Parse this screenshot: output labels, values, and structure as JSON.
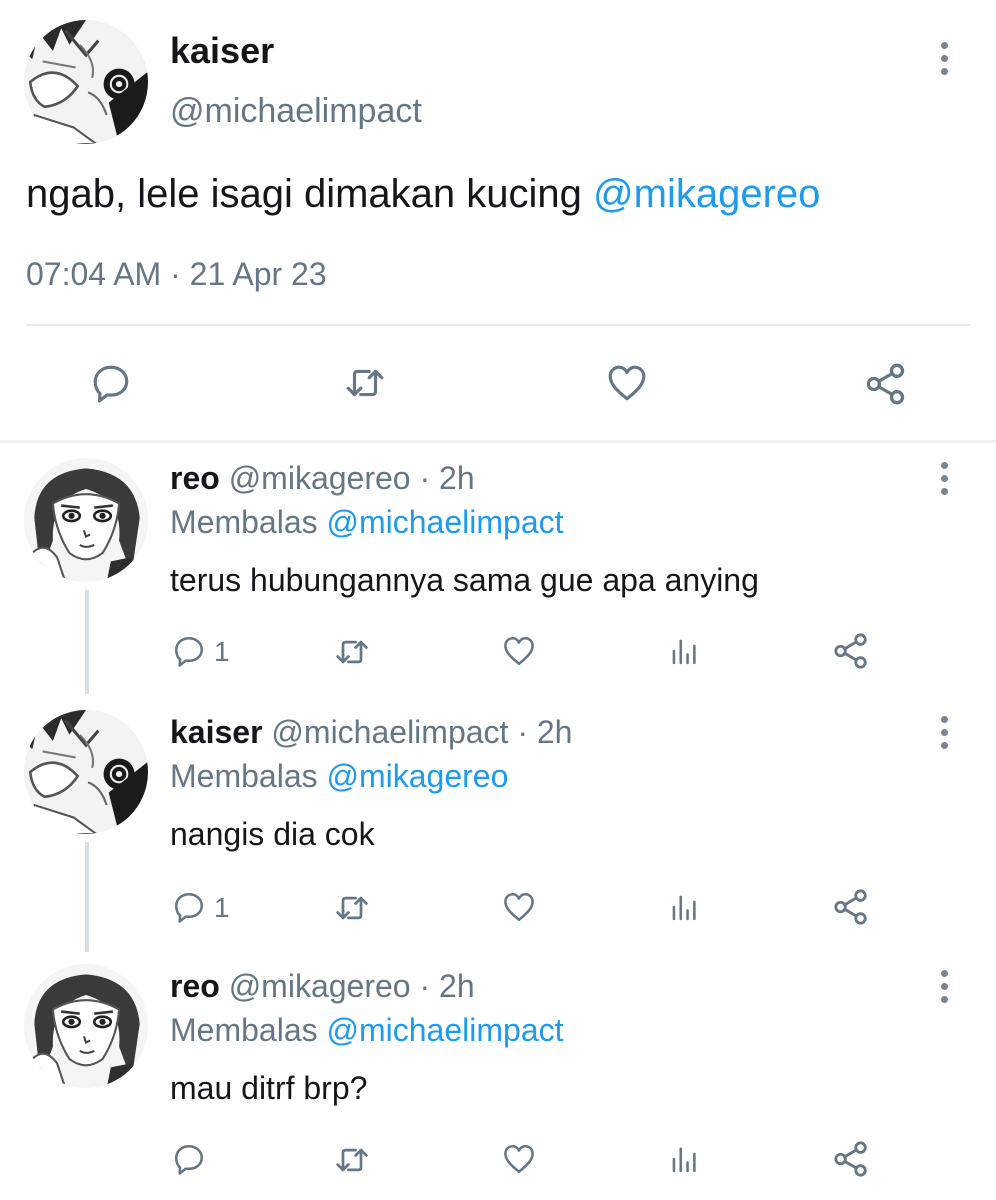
{
  "main_tweet": {
    "name": "kaiser",
    "handle": "@michaelimpact",
    "text": "ngab, lele isagi dimakan kucing ",
    "mention": "@mikagereo",
    "time": "07:04 AM",
    "separator": " · ",
    "date": "21 Apr 23"
  },
  "replies": [
    {
      "name": "reo",
      "handle": "@mikagereo",
      "age": "2h",
      "reply_label": "Membalas ",
      "reply_to": "@michaelimpact",
      "text": "terus hubungannya sama gue apa anying",
      "reply_count": "1"
    },
    {
      "name": "kaiser",
      "handle": "@michaelimpact",
      "age": "2h",
      "reply_label": "Membalas ",
      "reply_to": "@mikagereo",
      "text": "nangis dia cok",
      "reply_count": "1"
    },
    {
      "name": "reo",
      "handle": "@mikagereo",
      "age": "2h",
      "reply_label": "Membalas ",
      "reply_to": "@michaelimpact",
      "text": "mau ditrf brp?",
      "reply_count": ""
    }
  ],
  "colors": {
    "accent": "#1d9bf0",
    "icon_gray": "#657786",
    "divider": "#e6ecf0"
  },
  "icons": [
    "reply-icon",
    "retweet-icon",
    "like-icon",
    "share-icon",
    "analytics-icon",
    "more-icon"
  ]
}
